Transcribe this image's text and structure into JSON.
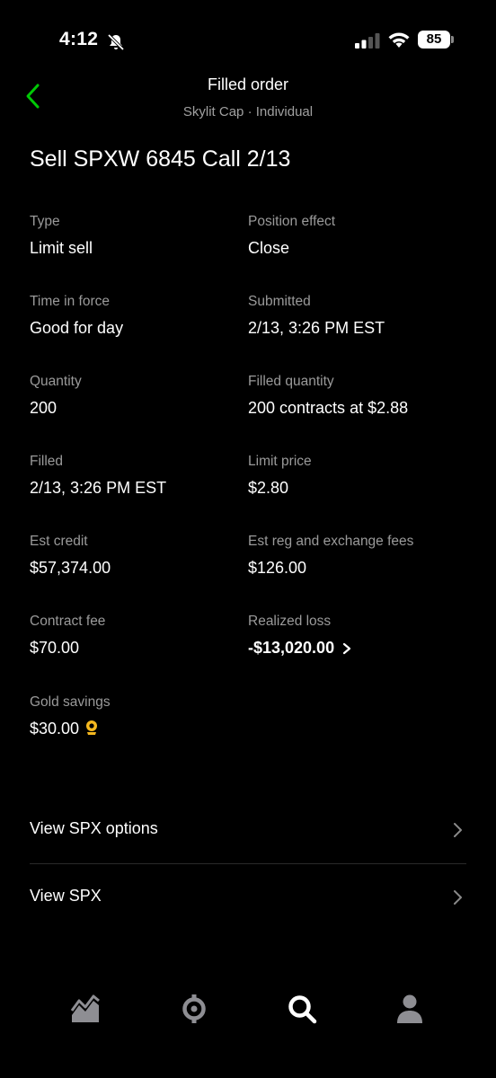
{
  "status_bar": {
    "time": "4:12",
    "battery": "85"
  },
  "header": {
    "title": "Filled order",
    "subtitle": "Skylit Cap · Individual"
  },
  "order_title": "Sell SPXW 6845 Call 2/13",
  "details": {
    "type": {
      "label": "Type",
      "value": "Limit sell"
    },
    "position_effect": {
      "label": "Position effect",
      "value": "Close"
    },
    "time_in_force": {
      "label": "Time in force",
      "value": "Good for day"
    },
    "submitted": {
      "label": "Submitted",
      "value": "2/13, 3:26 PM EST"
    },
    "quantity": {
      "label": "Quantity",
      "value": "200"
    },
    "filled_quantity": {
      "label": "Filled quantity",
      "value": "200 contracts at $2.88"
    },
    "filled": {
      "label": "Filled",
      "value": "2/13, 3:26 PM EST"
    },
    "limit_price": {
      "label": "Limit price",
      "value": "$2.80"
    },
    "est_credit": {
      "label": "Est credit",
      "value": "$57,374.00"
    },
    "est_fees": {
      "label": "Est reg and exchange fees",
      "value": "$126.00"
    },
    "contract_fee": {
      "label": "Contract fee",
      "value": "$70.00"
    },
    "realized_loss": {
      "label": "Realized loss",
      "value": "-$13,020.00"
    },
    "gold_savings": {
      "label": "Gold savings",
      "value": "$30.00"
    }
  },
  "links": {
    "view_options": "View SPX options",
    "view_spx": "View SPX"
  },
  "bottom_nav": [
    "chart-icon",
    "crypto-icon",
    "search-icon",
    "account-icon"
  ],
  "colors": {
    "accent_green": "#00c805",
    "gold": "#f5b81f",
    "label_gray": "#9a9a9a"
  }
}
